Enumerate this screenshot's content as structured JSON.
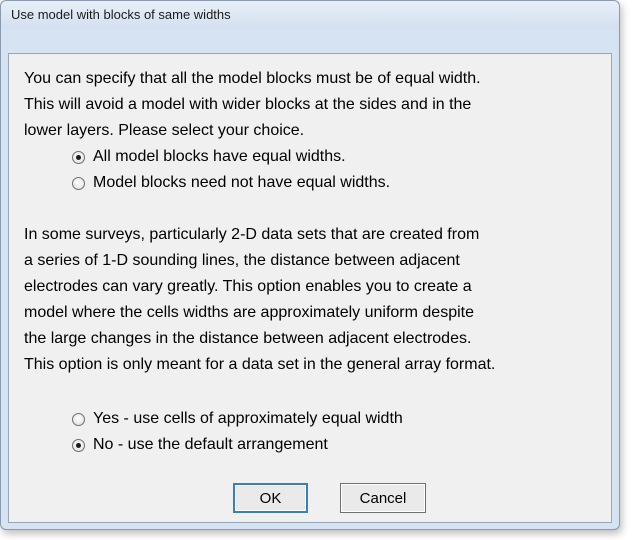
{
  "dialog": {
    "title": "Use model with blocks of same widths",
    "section1": {
      "text": "You can specify that all the model blocks must be of equal width.\nThis will avoid a model with wider blocks at the sides and in the\nlower layers. Please select your choice.",
      "options": [
        {
          "label": "All model blocks have equal widths.",
          "checked": true
        },
        {
          "label": "Model blocks need not have equal widths.",
          "checked": false
        }
      ]
    },
    "section2": {
      "text": "In some surveys, particularly 2-D data sets that are created from\na series of 1-D sounding lines, the distance between adjacent\nelectrodes can vary greatly. This option enables you to create a\nmodel where the cells widths are approximately uniform despite\nthe large changes in the distance between adjacent electrodes.\nThis option is only meant for a data set in the general array format.",
      "options": [
        {
          "label": "Yes - use cells of approximately equal width",
          "checked": false
        },
        {
          "label": "No - use the default arrangement",
          "checked": true
        }
      ]
    },
    "buttons": {
      "ok": "OK",
      "cancel": "Cancel"
    }
  }
}
